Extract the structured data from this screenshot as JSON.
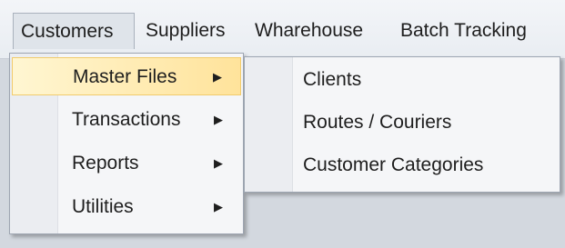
{
  "menubar": {
    "items": [
      {
        "label": "Customers",
        "open": true
      },
      {
        "label": "Suppliers",
        "open": false
      },
      {
        "label": "Wharehouse",
        "open": false
      },
      {
        "label": "Batch Tracking",
        "open": false
      }
    ]
  },
  "customers_menu": {
    "items": [
      {
        "label": "Master Files",
        "arrow": "▶",
        "highlighted": true
      },
      {
        "label": "Transactions",
        "arrow": "▶",
        "highlighted": false
      },
      {
        "label": "Reports",
        "arrow": "▶",
        "highlighted": false
      },
      {
        "label": "Utilities",
        "arrow": "▶",
        "highlighted": false
      }
    ]
  },
  "master_files_submenu": {
    "items": [
      {
        "label": "Clients"
      },
      {
        "label": "Routes / Couriers"
      },
      {
        "label": "Customer Categories"
      }
    ]
  },
  "colors": {
    "highlight_start": "#fff6d2",
    "highlight_end": "#ffe39b",
    "highlight_border": "#f1cb6c",
    "menu_background": "#f5f6f8"
  },
  "icons": {
    "submenu_arrow": "chevron-right-icon"
  }
}
